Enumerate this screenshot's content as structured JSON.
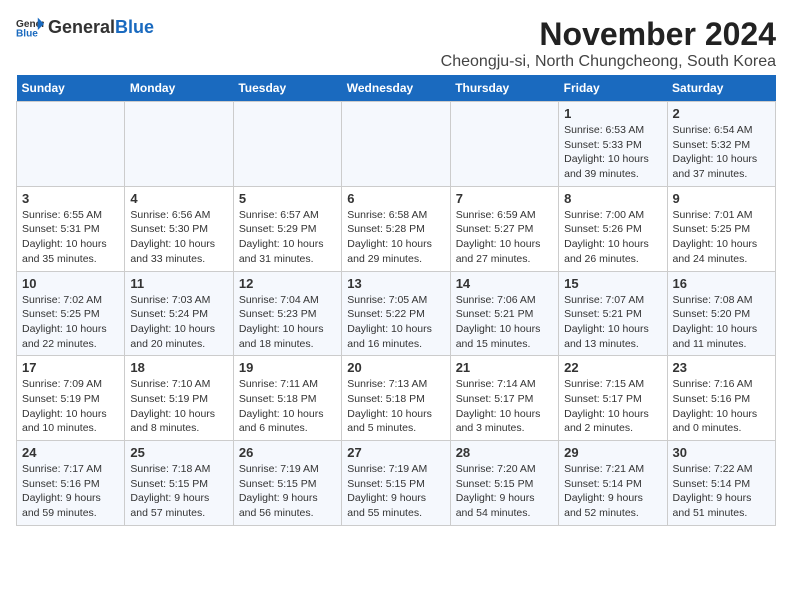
{
  "logo": {
    "text_general": "General",
    "text_blue": "Blue"
  },
  "title": "November 2024",
  "subtitle": "Cheongju-si, North Chungcheong, South Korea",
  "weekdays": [
    "Sunday",
    "Monday",
    "Tuesday",
    "Wednesday",
    "Thursday",
    "Friday",
    "Saturday"
  ],
  "weeks": [
    [
      {
        "day": "",
        "info": ""
      },
      {
        "day": "",
        "info": ""
      },
      {
        "day": "",
        "info": ""
      },
      {
        "day": "",
        "info": ""
      },
      {
        "day": "",
        "info": ""
      },
      {
        "day": "1",
        "info": "Sunrise: 6:53 AM\nSunset: 5:33 PM\nDaylight: 10 hours and 39 minutes."
      },
      {
        "day": "2",
        "info": "Sunrise: 6:54 AM\nSunset: 5:32 PM\nDaylight: 10 hours and 37 minutes."
      }
    ],
    [
      {
        "day": "3",
        "info": "Sunrise: 6:55 AM\nSunset: 5:31 PM\nDaylight: 10 hours and 35 minutes."
      },
      {
        "day": "4",
        "info": "Sunrise: 6:56 AM\nSunset: 5:30 PM\nDaylight: 10 hours and 33 minutes."
      },
      {
        "day": "5",
        "info": "Sunrise: 6:57 AM\nSunset: 5:29 PM\nDaylight: 10 hours and 31 minutes."
      },
      {
        "day": "6",
        "info": "Sunrise: 6:58 AM\nSunset: 5:28 PM\nDaylight: 10 hours and 29 minutes."
      },
      {
        "day": "7",
        "info": "Sunrise: 6:59 AM\nSunset: 5:27 PM\nDaylight: 10 hours and 27 minutes."
      },
      {
        "day": "8",
        "info": "Sunrise: 7:00 AM\nSunset: 5:26 PM\nDaylight: 10 hours and 26 minutes."
      },
      {
        "day": "9",
        "info": "Sunrise: 7:01 AM\nSunset: 5:25 PM\nDaylight: 10 hours and 24 minutes."
      }
    ],
    [
      {
        "day": "10",
        "info": "Sunrise: 7:02 AM\nSunset: 5:25 PM\nDaylight: 10 hours and 22 minutes."
      },
      {
        "day": "11",
        "info": "Sunrise: 7:03 AM\nSunset: 5:24 PM\nDaylight: 10 hours and 20 minutes."
      },
      {
        "day": "12",
        "info": "Sunrise: 7:04 AM\nSunset: 5:23 PM\nDaylight: 10 hours and 18 minutes."
      },
      {
        "day": "13",
        "info": "Sunrise: 7:05 AM\nSunset: 5:22 PM\nDaylight: 10 hours and 16 minutes."
      },
      {
        "day": "14",
        "info": "Sunrise: 7:06 AM\nSunset: 5:21 PM\nDaylight: 10 hours and 15 minutes."
      },
      {
        "day": "15",
        "info": "Sunrise: 7:07 AM\nSunset: 5:21 PM\nDaylight: 10 hours and 13 minutes."
      },
      {
        "day": "16",
        "info": "Sunrise: 7:08 AM\nSunset: 5:20 PM\nDaylight: 10 hours and 11 minutes."
      }
    ],
    [
      {
        "day": "17",
        "info": "Sunrise: 7:09 AM\nSunset: 5:19 PM\nDaylight: 10 hours and 10 minutes."
      },
      {
        "day": "18",
        "info": "Sunrise: 7:10 AM\nSunset: 5:19 PM\nDaylight: 10 hours and 8 minutes."
      },
      {
        "day": "19",
        "info": "Sunrise: 7:11 AM\nSunset: 5:18 PM\nDaylight: 10 hours and 6 minutes."
      },
      {
        "day": "20",
        "info": "Sunrise: 7:13 AM\nSunset: 5:18 PM\nDaylight: 10 hours and 5 minutes."
      },
      {
        "day": "21",
        "info": "Sunrise: 7:14 AM\nSunset: 5:17 PM\nDaylight: 10 hours and 3 minutes."
      },
      {
        "day": "22",
        "info": "Sunrise: 7:15 AM\nSunset: 5:17 PM\nDaylight: 10 hours and 2 minutes."
      },
      {
        "day": "23",
        "info": "Sunrise: 7:16 AM\nSunset: 5:16 PM\nDaylight: 10 hours and 0 minutes."
      }
    ],
    [
      {
        "day": "24",
        "info": "Sunrise: 7:17 AM\nSunset: 5:16 PM\nDaylight: 9 hours and 59 minutes."
      },
      {
        "day": "25",
        "info": "Sunrise: 7:18 AM\nSunset: 5:15 PM\nDaylight: 9 hours and 57 minutes."
      },
      {
        "day": "26",
        "info": "Sunrise: 7:19 AM\nSunset: 5:15 PM\nDaylight: 9 hours and 56 minutes."
      },
      {
        "day": "27",
        "info": "Sunrise: 7:19 AM\nSunset: 5:15 PM\nDaylight: 9 hours and 55 minutes."
      },
      {
        "day": "28",
        "info": "Sunrise: 7:20 AM\nSunset: 5:15 PM\nDaylight: 9 hours and 54 minutes."
      },
      {
        "day": "29",
        "info": "Sunrise: 7:21 AM\nSunset: 5:14 PM\nDaylight: 9 hours and 52 minutes."
      },
      {
        "day": "30",
        "info": "Sunrise: 7:22 AM\nSunset: 5:14 PM\nDaylight: 9 hours and 51 minutes."
      }
    ]
  ]
}
